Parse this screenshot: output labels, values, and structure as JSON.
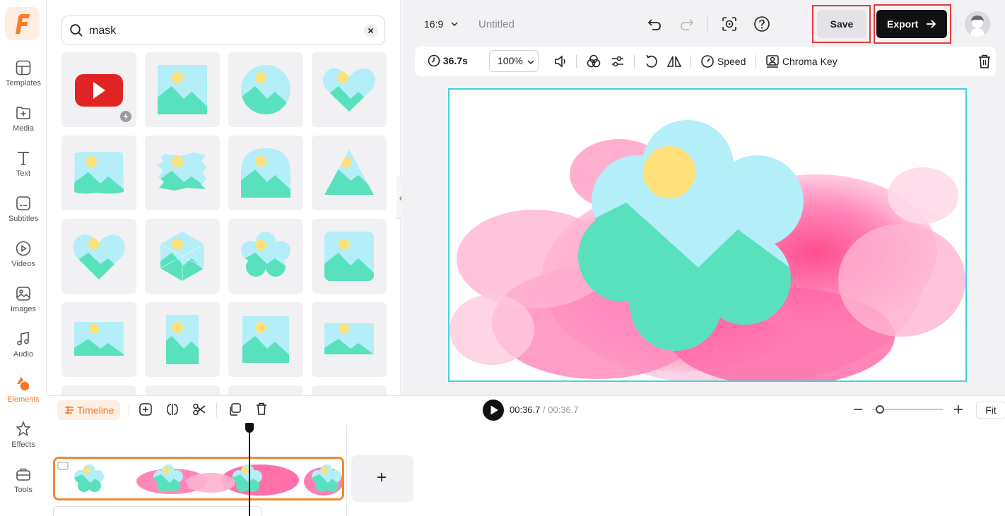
{
  "sidebar": {
    "items": [
      {
        "label": "Templates",
        "icon": "templates-icon"
      },
      {
        "label": "Media",
        "icon": "media-icon"
      },
      {
        "label": "Text",
        "icon": "text-icon"
      },
      {
        "label": "Subtitles",
        "icon": "subtitles-icon"
      },
      {
        "label": "Videos",
        "icon": "videos-icon"
      },
      {
        "label": "Images",
        "icon": "images-icon"
      },
      {
        "label": "Audio",
        "icon": "audio-icon"
      },
      {
        "label": "Elements",
        "icon": "elements-icon",
        "active": true
      },
      {
        "label": "Effects",
        "icon": "effects-icon"
      },
      {
        "label": "Tools",
        "icon": "tools-icon"
      }
    ]
  },
  "panel": {
    "search_value": "mask",
    "results": [
      "youtube-logo",
      "rectangle-mask",
      "circle-mask",
      "heart-mask",
      "brush-rect-mask",
      "brush-stroke-mask",
      "arch-mask",
      "triangle-mask",
      "heart-mask-2",
      "hexagon-mask",
      "flower-mask",
      "rounded-square-mask",
      "wide-rect-mask",
      "tall-rect-mask",
      "square-rect-mask",
      "landscape-rect-mask"
    ]
  },
  "header": {
    "aspect_ratio": "16:9",
    "project_title": "Untitled",
    "save_label": "Save",
    "export_label": "Export"
  },
  "edit_toolbar": {
    "duration": "36.7s",
    "zoom": "100%",
    "speed_label": "Speed",
    "chroma_key_label": "Chroma Key"
  },
  "timeline": {
    "tab_label": "Timeline",
    "current_time": "00:36.7",
    "separator": "/",
    "total_time": "00:36.7",
    "fit_label": "Fit",
    "add_clip_symbol": "+"
  },
  "colors": {
    "accent": "#f07a2a",
    "selection": "#40d3e2",
    "mask_sky": "#b3eef9",
    "mask_land": "#59e0bd",
    "mask_sun": "#fde07a",
    "ink": "#ff5fa0"
  }
}
